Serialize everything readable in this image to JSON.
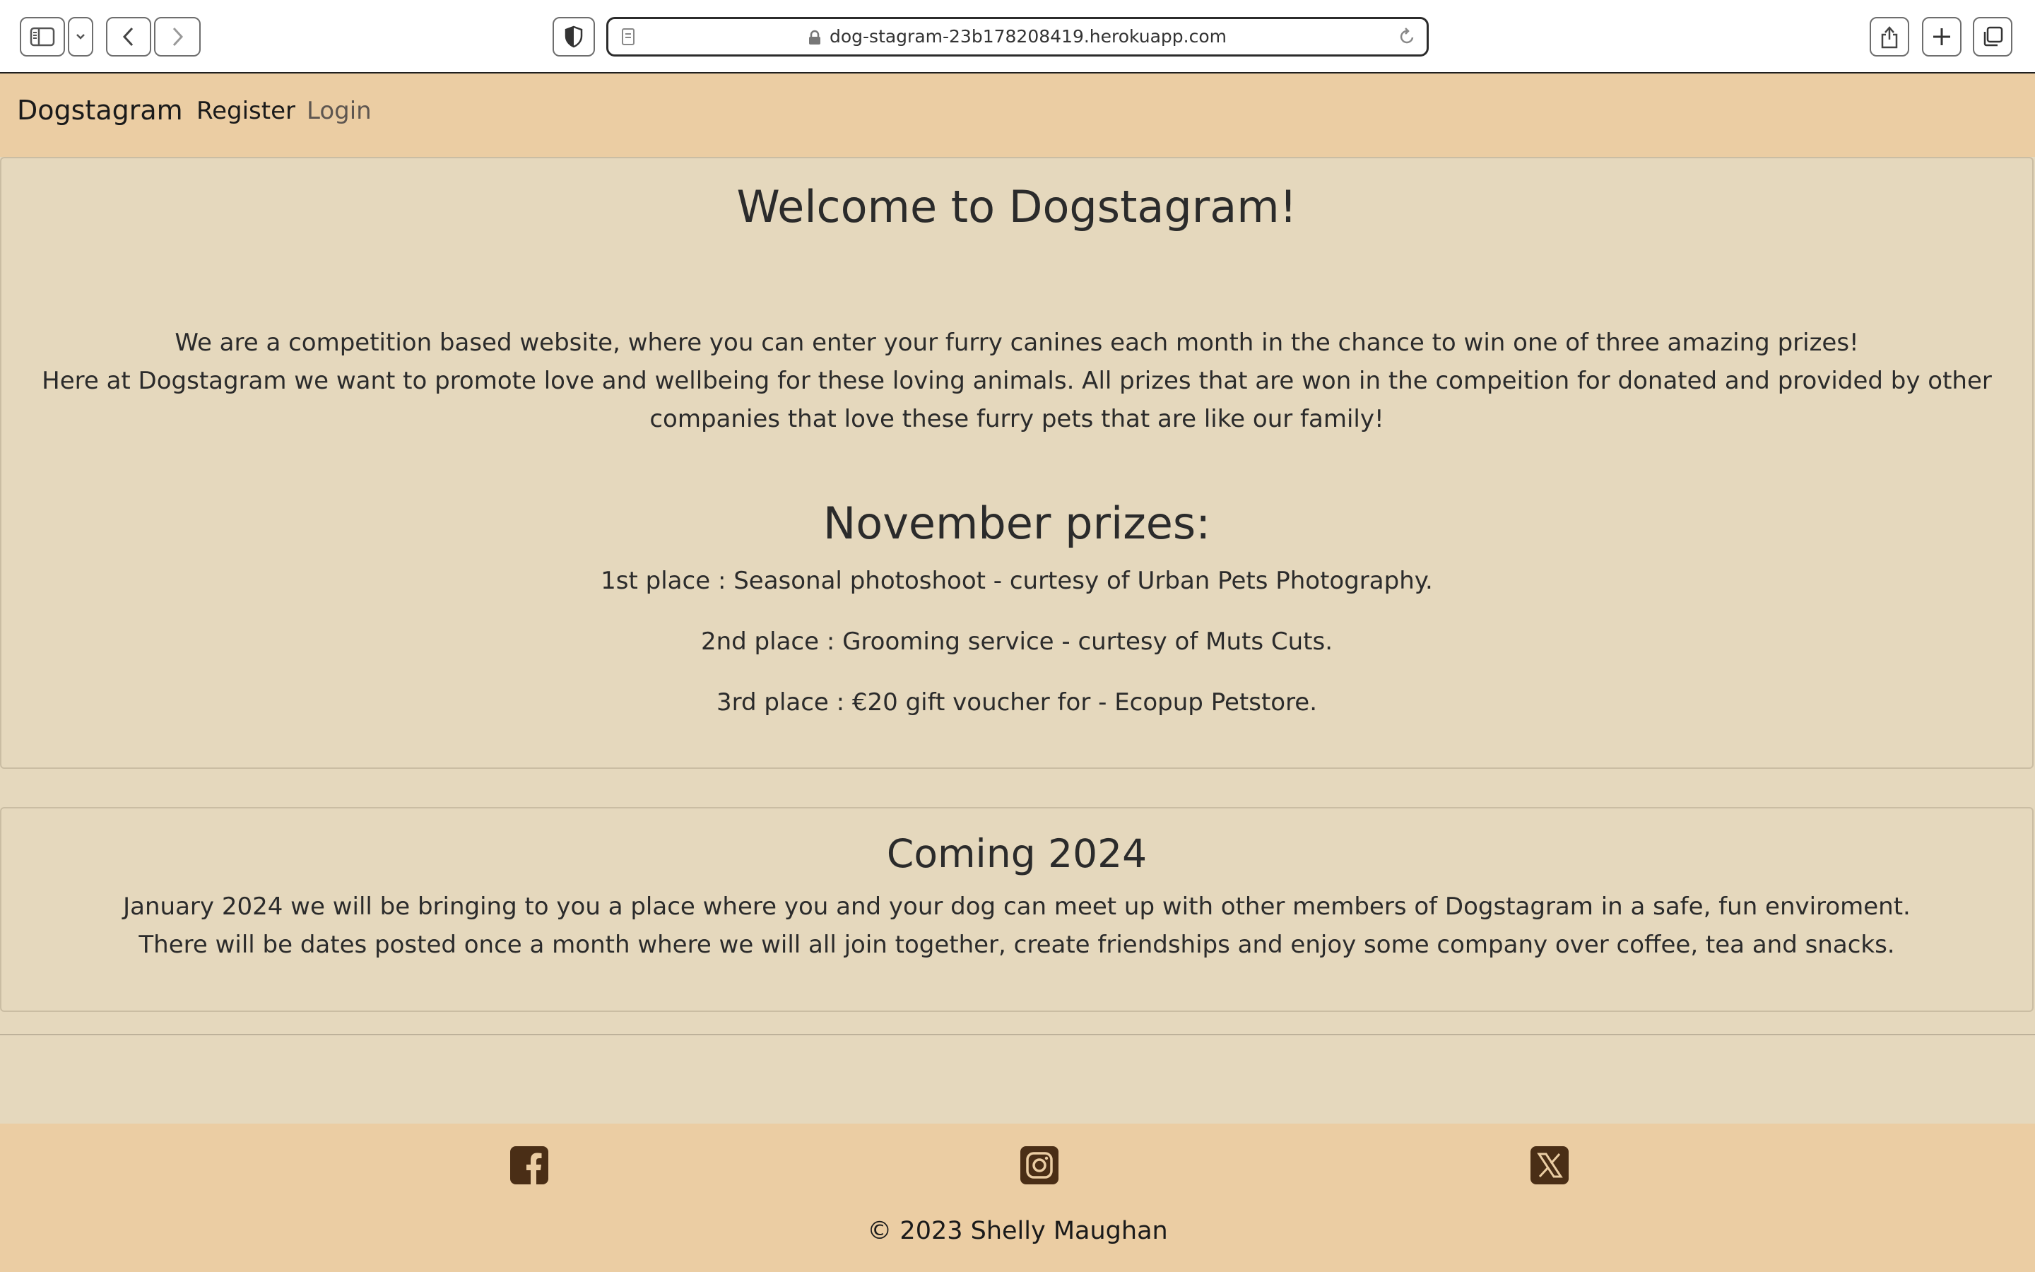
{
  "browser": {
    "url": "dog-stagram-23b178208419.herokuapp.com"
  },
  "navbar": {
    "brand": "Dogstagram",
    "links": [
      {
        "label": "Register"
      },
      {
        "label": "Login"
      }
    ]
  },
  "welcome": {
    "title": "Welcome to Dogstagram!",
    "intro_line1": "We are a competition based website, where you can enter your furry canines each month in the chance to win one of three amazing prizes!",
    "intro_line2": "Here at Dogstagram we want to promote love and wellbeing for these loving animals. All prizes that are won in the compeition for donated and provided by other companies that love these furry pets that are like our family!"
  },
  "prizes": {
    "title": "November prizes:",
    "items": [
      "1st place : Seasonal photoshoot - curtesy of Urban Pets Photography.",
      "2nd place : Grooming service - curtesy of Muts Cuts.",
      "3rd place : €20 gift voucher for - Ecopup Petstore."
    ]
  },
  "coming": {
    "title": "Coming 2024",
    "body": "January 2024 we will be bringing to you a place where you and your dog can meet up with other members of Dogstagram in a safe, fun enviroment. There will be dates posted once a month where we will all join together, create friendships and enjoy some company over coffee, tea and snacks."
  },
  "footer": {
    "social_icons": [
      "facebook-icon",
      "instagram-icon",
      "x-twitter-icon"
    ],
    "copyright": "© 2023 Shelly Maughan"
  },
  "colors": {
    "nav_footer_bg": "#ebcda3",
    "page_bg": "#e5d8bd",
    "icon_color": "#4a2e16"
  }
}
